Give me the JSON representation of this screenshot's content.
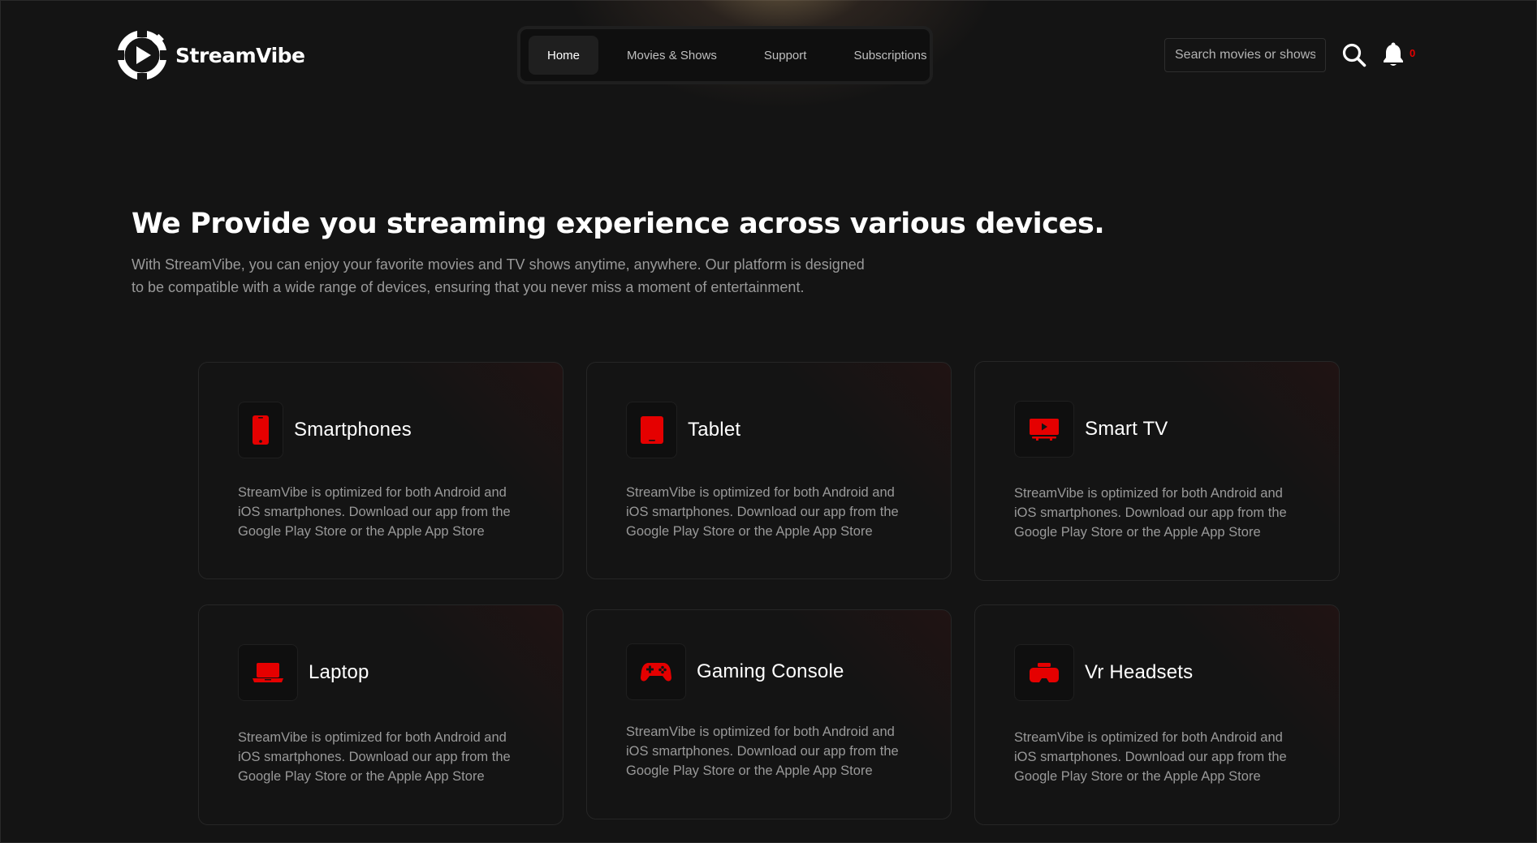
{
  "brand": {
    "name": "StreamVibe",
    "accent_color": "#e50000",
    "background_color": "#141414"
  },
  "nav": {
    "items": [
      {
        "label": "Home",
        "active": true
      },
      {
        "label": "Movies & Shows",
        "active": false
      },
      {
        "label": "Support",
        "active": false
      },
      {
        "label": "Subscriptions",
        "active": false
      }
    ]
  },
  "header": {
    "search_placeholder": "Search movies or shows",
    "search_icon": "search-icon",
    "bell_icon": "bell-icon",
    "notification_count": "0"
  },
  "hero": {
    "title": "We Provide you streaming experience across various devices.",
    "text": "With StreamVibe, you can enjoy your favorite movies and TV shows anytime, anywhere. Our platform is designed to be compatible with a wide range of devices, ensuring that you never miss a moment of entertainment."
  },
  "devices": [
    {
      "title": "Smartphones",
      "icon": "smartphone-icon",
      "description": "StreamVibe is optimized for both Android and iOS smartphones. Download our app from the Google Play Store or the Apple App Store"
    },
    {
      "title": "Tablet",
      "icon": "tablet-icon",
      "description": "StreamVibe is optimized for both Android and iOS smartphones. Download our app from the Google Play Store or the Apple App Store"
    },
    {
      "title": "Smart TV",
      "icon": "smart-tv-icon",
      "description": "StreamVibe is optimized for both Android and iOS smartphones. Download our app from the Google Play Store or the Apple App Store"
    },
    {
      "title": "Laptop",
      "icon": "laptop-icon",
      "description": "StreamVibe is optimized for both Android and iOS smartphones. Download our app from the Google Play Store or the Apple App Store"
    },
    {
      "title": "Gaming Console",
      "icon": "gamepad-icon",
      "description": "StreamVibe is optimized for both Android and iOS smartphones. Download our app from the Google Play Store or the Apple App Store"
    },
    {
      "title": "Vr Headsets",
      "icon": "vr-headset-icon",
      "description": "StreamVibe is optimized for both Android and iOS smartphones. Download our app from the Google Play Store or the Apple App Store"
    }
  ]
}
